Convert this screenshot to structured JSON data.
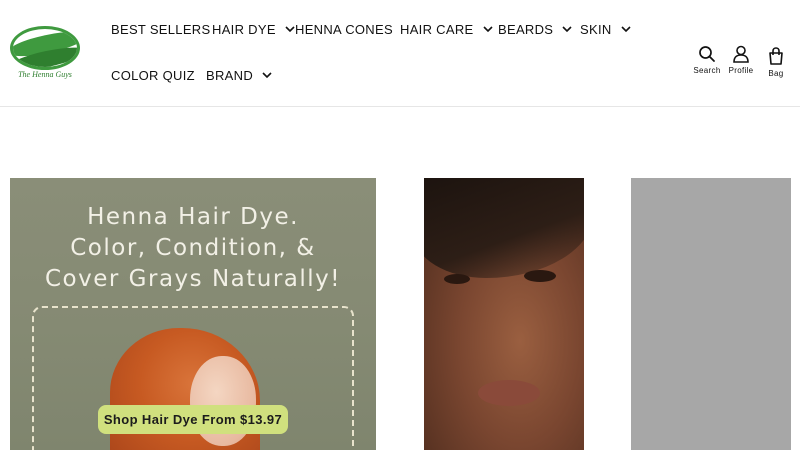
{
  "brand": {
    "logo_text": "The Henna Guys",
    "primary_color": "#3f9a3f"
  },
  "nav": {
    "items": [
      {
        "label": "BEST SELLERS",
        "has_dropdown": false
      },
      {
        "label": "HAIR DYE",
        "has_dropdown": true
      },
      {
        "label": "HENNA CONES",
        "has_dropdown": false
      },
      {
        "label": "HAIR CARE",
        "has_dropdown": true
      },
      {
        "label": "BEARDS",
        "has_dropdown": true
      },
      {
        "label": "SKIN",
        "has_dropdown": true
      },
      {
        "label": "COLOR QUIZ",
        "has_dropdown": false
      },
      {
        "label": "BRAND",
        "has_dropdown": true
      }
    ]
  },
  "actions": {
    "search_label": "Search",
    "profile_label": "Profile",
    "bag_label": "Bag"
  },
  "hero": {
    "title_lines": [
      "Henna Hair Dye.",
      "Color, Condition, &",
      "Cover Grays Naturally!"
    ],
    "cta_label": "Shop Hair Dye From $13.97",
    "cta_color": "#d0e07e",
    "background_color": "#868b74"
  }
}
